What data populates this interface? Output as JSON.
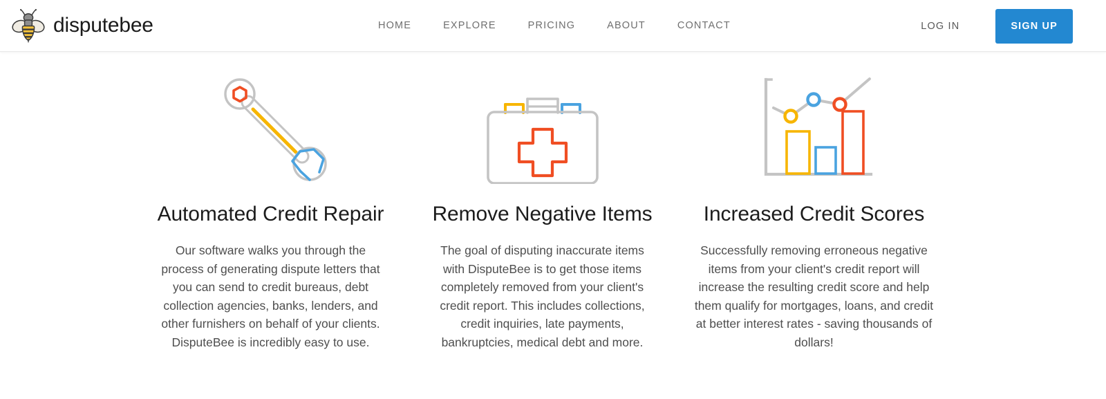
{
  "brand": {
    "name": "disputebee",
    "logo_icon": "bee-icon"
  },
  "nav": {
    "items": [
      {
        "label": "HOME"
      },
      {
        "label": "EXPLORE"
      },
      {
        "label": "PRICING"
      },
      {
        "label": "ABOUT"
      },
      {
        "label": "CONTACT"
      }
    ]
  },
  "actions": {
    "login_label": "LOG IN",
    "signup_label": "SIGN UP",
    "signup_color": "#2388d1"
  },
  "colors": {
    "accent_blue": "#2388d1",
    "icon_gray": "#b3b3b3",
    "icon_orange": "#f04e23",
    "icon_yellow": "#f7b500",
    "icon_blue": "#4aa3e0",
    "heading": "#1c1c1c",
    "body_text": "#4e4e4e",
    "nav_text": "#6f6f6f"
  },
  "features": [
    {
      "icon": "wrench-icon",
      "title": "Automated Credit Repair",
      "text": "Our software walks you through the process of generating dispute letters that you can send to credit bureaus, debt collection agencies, banks, lenders, and other furnishers on behalf of your clients. DisputeBee is incredibly easy to use."
    },
    {
      "icon": "first-aid-kit-icon",
      "title": "Remove Negative Items",
      "text": "The goal of disputing inaccurate items with DisputeBee is to get those items completely removed from your client's credit report. This includes collections, credit inquiries, late payments, bankruptcies, medical debt and more."
    },
    {
      "icon": "bar-chart-icon",
      "title": "Increased Credit Scores",
      "text": "Successfully removing erroneous negative items from your client's credit report will increase the resulting credit score and help them qualify for mortgages, loans, and credit at better interest rates - saving thousands of dollars!"
    }
  ]
}
